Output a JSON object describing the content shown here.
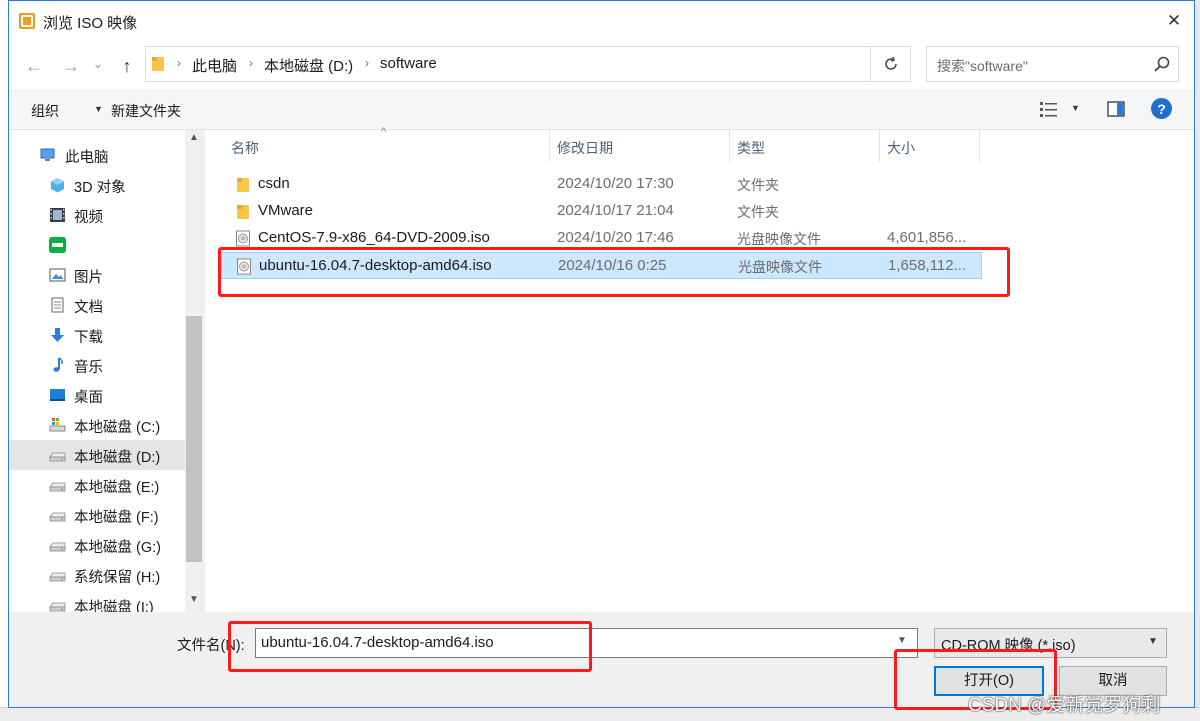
{
  "dialog": {
    "title": "浏览 ISO 映像",
    "close_symbol": "✕"
  },
  "nav": {
    "back_symbol": "←",
    "forward_symbol": "→",
    "recent_symbol": "⌄",
    "up_symbol": "↑",
    "breadcrumb": [
      "此电脑",
      "本地磁盘 (D:)",
      "software"
    ],
    "search_placeholder": "搜索\"software\""
  },
  "toolbar": {
    "organize_label": "组织",
    "new_folder_label": "新建文件夹",
    "help_label": "?"
  },
  "sidebar": {
    "items": [
      {
        "label": "此电脑",
        "icon": "computer-icon"
      },
      {
        "label": "3D 对象",
        "icon": "cube-3d-icon"
      },
      {
        "label": "视频",
        "icon": "video-icon"
      },
      {
        "label": "",
        "icon": "iqiyi-icon"
      },
      {
        "label": "图片",
        "icon": "pictures-icon"
      },
      {
        "label": "文档",
        "icon": "document-icon"
      },
      {
        "label": "下载",
        "icon": "download-icon"
      },
      {
        "label": "音乐",
        "icon": "music-icon"
      },
      {
        "label": "桌面",
        "icon": "desktop-icon"
      },
      {
        "label": "本地磁盘 (C:)",
        "icon": "system-drive-icon"
      },
      {
        "label": "本地磁盘 (D:)",
        "icon": "drive-icon",
        "selected": true
      },
      {
        "label": "本地磁盘 (E:)",
        "icon": "drive-icon"
      },
      {
        "label": "本地磁盘 (F:)",
        "icon": "drive-icon"
      },
      {
        "label": "本地磁盘 (G:)",
        "icon": "drive-icon"
      },
      {
        "label": "系统保留 (H:)",
        "icon": "drive-icon"
      },
      {
        "label": "本地磁盘 (I:)",
        "icon": "drive-icon"
      }
    ]
  },
  "filelist": {
    "columns": {
      "name": "名称",
      "modified": "修改日期",
      "type": "类型",
      "size": "大小"
    },
    "rows": [
      {
        "name": "csdn",
        "modified": "2024/10/20 17:30",
        "type": "文件夹",
        "size": "",
        "icon": "folder-icon"
      },
      {
        "name": "VMware",
        "modified": "2024/10/17 21:04",
        "type": "文件夹",
        "size": "",
        "icon": "folder-icon"
      },
      {
        "name": "CentOS-7.9-x86_64-DVD-2009.iso",
        "modified": "2024/10/20 17:46",
        "type": "光盘映像文件",
        "size": "4,601,856...",
        "icon": "disc-image-icon"
      },
      {
        "name": "ubuntu-16.04.7-desktop-amd64.iso",
        "modified": "2024/10/16 0:25",
        "type": "光盘映像文件",
        "size": "1,658,112...",
        "icon": "disc-image-icon",
        "selected": true
      }
    ]
  },
  "footer": {
    "filename_label": "文件名(N):",
    "filename_value": "ubuntu-16.04.7-desktop-amd64.iso",
    "filetype_value": "CD-ROM 映像 (*.iso)",
    "open_label": "打开(O)",
    "cancel_label": "取消"
  },
  "watermark": "CSDN @爱新觉罗狗剩",
  "colors": {
    "accent": "#0078d7",
    "selection": "#cce8ff",
    "annotation_red": "#ff1a1a",
    "folder": "#f7c548"
  }
}
